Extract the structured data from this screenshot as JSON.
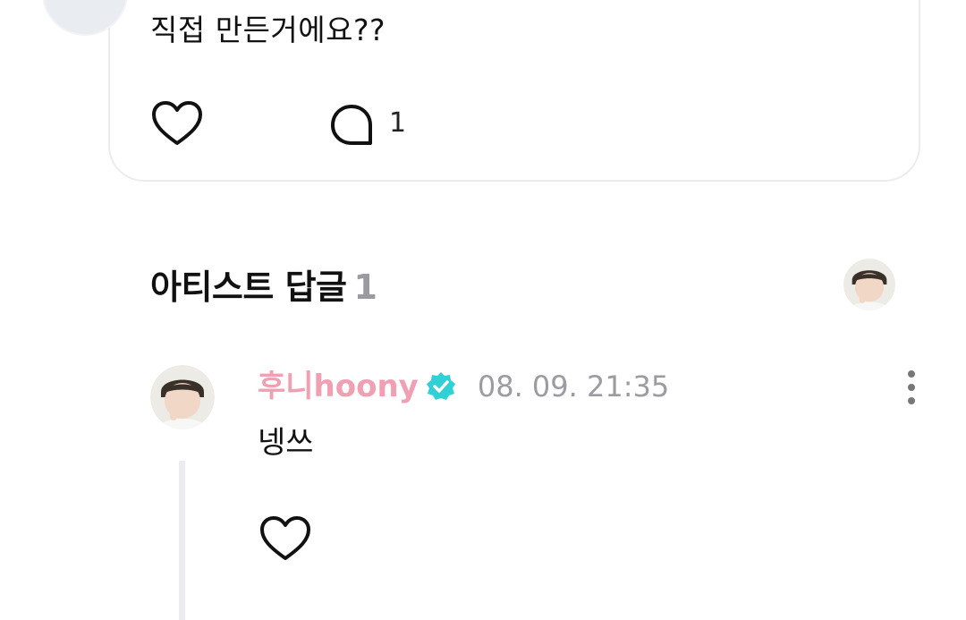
{
  "comment": {
    "text": "직접 만든거에요??",
    "reply_count": "1"
  },
  "artist_replies": {
    "title": "아티스트 답글",
    "count": "1"
  },
  "reply": {
    "author": "후니hoony",
    "timestamp": "08. 09. 21:35",
    "text": "넹쓰"
  },
  "icons": {
    "like": "heart-outline-icon",
    "comment": "speech-bubble-icon",
    "verified": "verified-badge-icon",
    "more": "more-vertical-icon"
  },
  "colors": {
    "author_name": "#f0a0b2",
    "verified_badge": "#2fd0d6",
    "muted_text": "#9b9ba2",
    "card_border": "#ececef"
  }
}
